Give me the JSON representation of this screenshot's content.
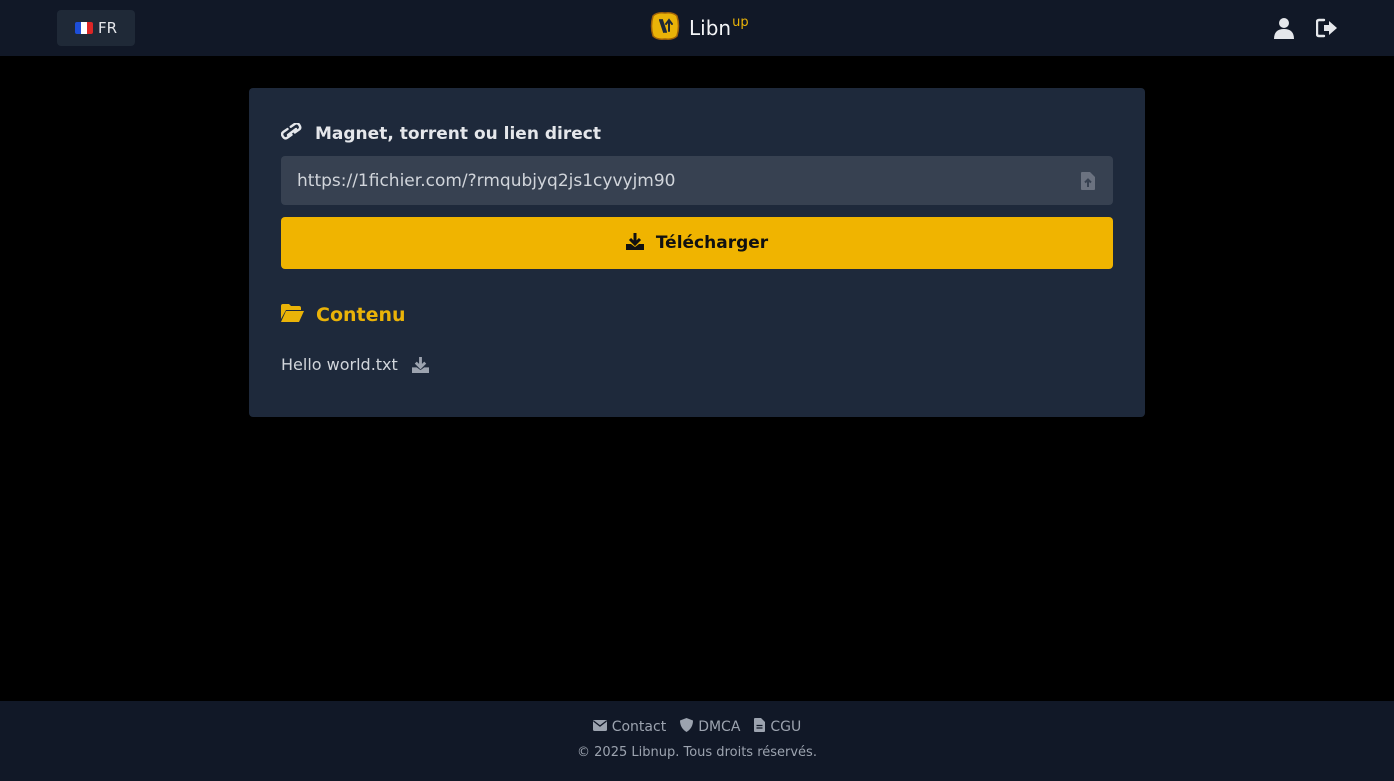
{
  "header": {
    "language_label": "FR",
    "brand_name": "Libn",
    "brand_sup": "up",
    "icons": {
      "account": "user-icon",
      "logout": "logout-icon",
      "flag": "france-flag-icon"
    }
  },
  "form": {
    "label": "Magnet, torrent ou lien direct",
    "url_value": "https://1fichier.com/?rmqubjyq2js1cyvyjm90",
    "button_label": "Télécharger"
  },
  "content": {
    "title": "Contenu",
    "files": [
      {
        "name": "Hello world.txt"
      }
    ]
  },
  "footer": {
    "links": [
      {
        "label": "Contact",
        "icon": "envelope-icon"
      },
      {
        "label": "DMCA",
        "icon": "shield-icon"
      },
      {
        "label": "CGU",
        "icon": "document-icon"
      }
    ],
    "copyright": "© 2025 Libnup. Tous droits réservés."
  },
  "colors": {
    "accent": "#f0b400",
    "navbar": "#111827",
    "card": "#1e293b",
    "input": "#374151",
    "background": "#000000"
  }
}
